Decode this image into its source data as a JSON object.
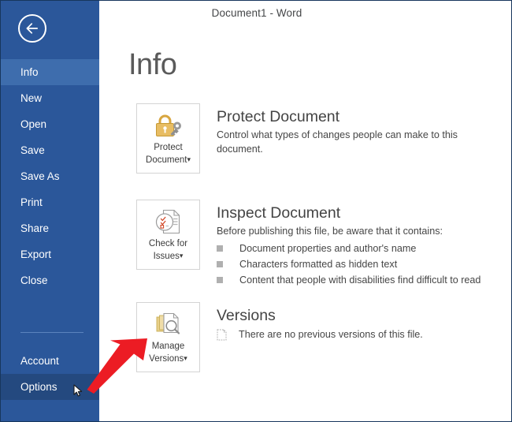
{
  "window": {
    "title": "Document1 - Word"
  },
  "sidebar": {
    "back_button": {
      "name": "back-arrow",
      "icon": "arrow-left-icon"
    },
    "items": [
      {
        "label": "Info",
        "state": "selected"
      },
      {
        "label": "New",
        "state": "normal"
      },
      {
        "label": "Open",
        "state": "normal"
      },
      {
        "label": "Save",
        "state": "normal"
      },
      {
        "label": "Save As",
        "state": "normal"
      },
      {
        "label": "Print",
        "state": "normal"
      },
      {
        "label": "Share",
        "state": "normal"
      },
      {
        "label": "Export",
        "state": "normal"
      },
      {
        "label": "Close",
        "state": "normal"
      }
    ],
    "bottom_items": [
      {
        "label": "Account",
        "state": "normal"
      },
      {
        "label": "Options",
        "state": "hovered"
      }
    ],
    "colors": {
      "background": "#2b579a",
      "selected": "#3e6dad",
      "hovered": "#24497f",
      "separator": "#5b83bd",
      "text": "#ffffff"
    }
  },
  "main": {
    "page_title": "Info",
    "sections": [
      {
        "id": "protect-document",
        "tile": {
          "icon": "padlock-key-icon",
          "label_line1": "Protect",
          "label_line2": "Document",
          "caret": "▾"
        },
        "heading": "Protect Document",
        "description": "Control what types of changes people can make to this document."
      },
      {
        "id": "inspect-document",
        "tile": {
          "icon": "check-document-icon",
          "label_line1": "Check for",
          "label_line2": "Issues",
          "caret": "▾"
        },
        "heading": "Inspect Document",
        "description": "Before publishing this file, be aware that it contains:",
        "bullets": [
          "Document properties and author's name",
          "Characters formatted as hidden text",
          "Content that people with disabilities find difficult to read"
        ]
      },
      {
        "id": "versions",
        "tile": {
          "icon": "manage-versions-icon",
          "label_line1": "Manage",
          "label_line2": "Versions",
          "caret": "▾"
        },
        "heading": "Versions",
        "versions_note": "There are no previous versions of this file.",
        "versions_note_icon": "dotted-document-icon"
      }
    ]
  },
  "annotation": {
    "arrow": {
      "icon": "red-arrow-icon",
      "color": "#e81b1b",
      "points_to": "Options"
    },
    "cursor": {
      "icon": "mouse-pointer-icon"
    }
  }
}
